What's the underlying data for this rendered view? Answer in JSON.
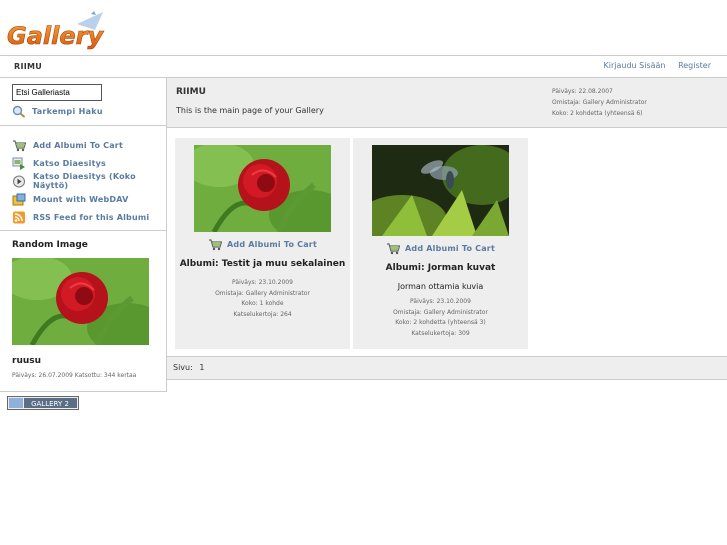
{
  "header": {
    "logo_text": "Gallery"
  },
  "breadcrumb": {
    "current": "RIIMU"
  },
  "system_links": {
    "login": "Kirjaudu Sisään",
    "register": "Register"
  },
  "sidebar": {
    "search_value": "Etsi Galleriasta",
    "advanced_search": "Tarkempi Haku",
    "actions": [
      {
        "label": "Add Albumi To Cart",
        "icon": "cart-icon"
      },
      {
        "label": "Katso Diaesitys",
        "icon": "slideshow-icon"
      },
      {
        "label": "Katso Diaesitys (Koko Näyttö)",
        "icon": "play-icon"
      },
      {
        "label": "Mount with WebDAV",
        "icon": "webdav-icon"
      },
      {
        "label": "RSS Feed for this Albumi",
        "icon": "rss-icon"
      }
    ],
    "random_image": {
      "title": "Random Image",
      "caption": "ruusu",
      "info": "Päiväys: 26.07.2009 Katsottu: 344 kertaa"
    },
    "badge_text": "GALLERY 2"
  },
  "album": {
    "title": "RIIMU",
    "description": "This is the main page of your Gallery",
    "meta": [
      "Päiväys: 22.08.2007",
      "Omistaja: Gallery Administrator",
      "Koko: 2 kohdetta (yhteensä 6)"
    ]
  },
  "items": [
    {
      "cart_label": "Add Albumi To Cart",
      "title": "Albumi: Testit ja muu sekalainen",
      "subtitle": "",
      "meta": [
        "Päiväys: 23.10.2009",
        "Omistaja: Gallery Administrator",
        "Koko: 1 kohde",
        "Katselukertoja: 264"
      ]
    },
    {
      "cart_label": "Add Albumi To Cart",
      "title": "Albumi: Jorman kuvat",
      "subtitle": "Jorman ottamia kuvia",
      "meta": [
        "Päiväys: 23.10.2009",
        "Omistaja: Gallery Administrator",
        "Koko: 2 kohdetta (yhteensä 3)",
        "Katselukertoja: 309"
      ]
    }
  ],
  "pager": {
    "label": "Sivu:",
    "page": "1"
  },
  "colors": {
    "link": "#5a7aa0",
    "panel": "#eeeeee",
    "logo_orange": "#e8741c"
  }
}
